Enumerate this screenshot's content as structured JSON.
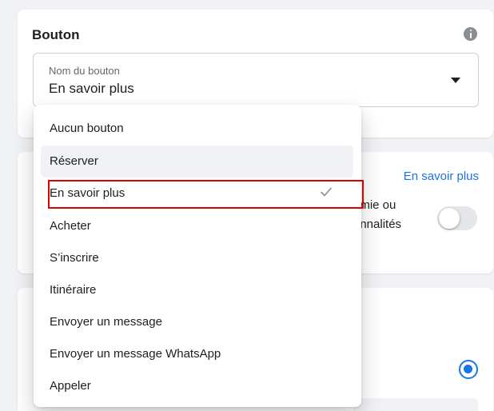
{
  "button_card": {
    "title": "Bouton",
    "info_icon": "info-icon",
    "select": {
      "label": "Nom du bouton",
      "value": "En savoir plus",
      "caret_icon": "caret-down-icon"
    }
  },
  "second_card": {
    "link": "En savoir plus",
    "partial_line_1": "omie ou",
    "partial_line_2": "onnalités",
    "toggle_state": "off"
  },
  "third_card": {
    "radio_state": "selected"
  },
  "dropdown": {
    "items": [
      {
        "label": "Aucun bouton"
      },
      {
        "label": "Réserver",
        "hovered": true
      },
      {
        "label": "En savoir plus",
        "selected": true,
        "icon": "check-icon"
      },
      {
        "label": "Acheter"
      },
      {
        "label": "S’inscrire"
      },
      {
        "label": "Itinéraire"
      },
      {
        "label": "Envoyer un message"
      },
      {
        "label": "Envoyer un message WhatsApp"
      },
      {
        "label": "Appeler"
      }
    ]
  },
  "colors": {
    "accent": "#1b74e4",
    "highlight_box": "#e00000",
    "page_bg": "#f0f2f5"
  }
}
